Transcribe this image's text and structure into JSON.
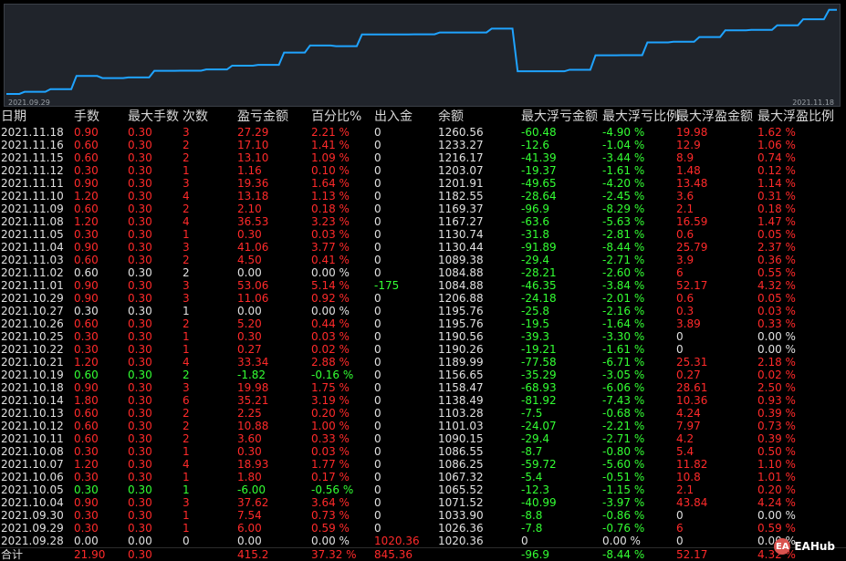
{
  "colors": {
    "white": "#e0e0e0",
    "red": "#ff2a2a",
    "green": "#33ff33",
    "line": "#1fa3ff"
  },
  "chart": {
    "x_start_label": "2021.09.29",
    "x_end_label": "2021.11.18"
  },
  "chart_data": {
    "type": "line",
    "x": [
      "2021.09.28",
      "2021.09.29",
      "2021.09.30",
      "2021.10.04",
      "2021.10.05",
      "2021.10.06",
      "2021.10.07",
      "2021.10.08",
      "2021.10.11",
      "2021.10.12",
      "2021.10.13",
      "2021.10.14",
      "2021.10.18",
      "2021.10.19",
      "2021.10.21",
      "2021.10.22",
      "2021.10.25",
      "2021.10.26",
      "2021.10.27",
      "2021.10.29",
      "2021.11.01",
      "2021.11.02",
      "2021.11.03",
      "2021.11.04",
      "2021.11.05",
      "2021.11.08",
      "2021.11.09",
      "2021.11.10",
      "2021.11.11",
      "2021.11.12",
      "2021.11.15",
      "2021.11.16",
      "2021.11.18"
    ],
    "values": [
      1020.36,
      1026.36,
      1033.9,
      1071.52,
      1065.52,
      1067.32,
      1086.25,
      1086.55,
      1090.15,
      1101.03,
      1103.28,
      1138.49,
      1158.47,
      1156.65,
      1189.99,
      1190.26,
      1190.56,
      1195.76,
      1195.76,
      1206.88,
      1084.88,
      1084.88,
      1089.38,
      1130.44,
      1130.74,
      1167.27,
      1169.37,
      1182.55,
      1201.91,
      1203.07,
      1216.17,
      1233.27,
      1260.56
    ],
    "ylim": [
      1015,
      1265
    ]
  },
  "table": {
    "headers": [
      "日期",
      "手数",
      "最大手数",
      "次数",
      "盈亏金额",
      "百分比%",
      "出入金",
      "余额",
      "最大浮亏金额",
      "最大浮亏比例",
      "最大浮盈金额",
      "最大浮盈比例"
    ],
    "rows": [
      {
        "date": "2021.11.18",
        "lots": "0.90",
        "maxlots": "0.30",
        "count": "3",
        "pnl": "27.29",
        "pct": "2.21 %",
        "flow": "0",
        "bal": "1260.56",
        "mdd": "-60.48",
        "mddp": "-4.90 %",
        "mfe": "19.98",
        "mfep": "1.62 %",
        "c": "red"
      },
      {
        "date": "2021.11.16",
        "lots": "0.60",
        "maxlots": "0.30",
        "count": "2",
        "pnl": "17.10",
        "pct": "1.41 %",
        "flow": "0",
        "bal": "1233.27",
        "mdd": "-12.6",
        "mddp": "-1.04 %",
        "mfe": "12.9",
        "mfep": "1.06 %",
        "c": "red"
      },
      {
        "date": "2021.11.15",
        "lots": "0.60",
        "maxlots": "0.30",
        "count": "2",
        "pnl": "13.10",
        "pct": "1.09 %",
        "flow": "0",
        "bal": "1216.17",
        "mdd": "-41.39",
        "mddp": "-3.44 %",
        "mfe": "8.9",
        "mfep": "0.74 %",
        "c": "red"
      },
      {
        "date": "2021.11.12",
        "lots": "0.30",
        "maxlots": "0.30",
        "count": "1",
        "pnl": "1.16",
        "pct": "0.10 %",
        "flow": "0",
        "bal": "1203.07",
        "mdd": "-19.37",
        "mddp": "-1.61 %",
        "mfe": "1.48",
        "mfep": "0.12 %",
        "c": "red"
      },
      {
        "date": "2021.11.11",
        "lots": "0.90",
        "maxlots": "0.30",
        "count": "3",
        "pnl": "19.36",
        "pct": "1.64 %",
        "flow": "0",
        "bal": "1201.91",
        "mdd": "-49.65",
        "mddp": "-4.20 %",
        "mfe": "13.48",
        "mfep": "1.14 %",
        "c": "red"
      },
      {
        "date": "2021.11.10",
        "lots": "1.20",
        "maxlots": "0.30",
        "count": "4",
        "pnl": "13.18",
        "pct": "1.13 %",
        "flow": "0",
        "bal": "1182.55",
        "mdd": "-28.64",
        "mddp": "-2.45 %",
        "mfe": "3.6",
        "mfep": "0.31 %",
        "c": "red"
      },
      {
        "date": "2021.11.09",
        "lots": "0.60",
        "maxlots": "0.30",
        "count": "2",
        "pnl": "2.10",
        "pct": "0.18 %",
        "flow": "0",
        "bal": "1169.37",
        "mdd": "-96.9",
        "mddp": "-8.29 %",
        "mfe": "2.1",
        "mfep": "0.18 %",
        "c": "red"
      },
      {
        "date": "2021.11.08",
        "lots": "1.20",
        "maxlots": "0.30",
        "count": "4",
        "pnl": "36.53",
        "pct": "3.23 %",
        "flow": "0",
        "bal": "1167.27",
        "mdd": "-63.6",
        "mddp": "-5.63 %",
        "mfe": "16.59",
        "mfep": "1.47 %",
        "c": "red"
      },
      {
        "date": "2021.11.05",
        "lots": "0.30",
        "maxlots": "0.30",
        "count": "1",
        "pnl": "0.30",
        "pct": "0.03 %",
        "flow": "0",
        "bal": "1130.74",
        "mdd": "-31.8",
        "mddp": "-2.81 %",
        "mfe": "0.6",
        "mfep": "0.05 %",
        "c": "red"
      },
      {
        "date": "2021.11.04",
        "lots": "0.90",
        "maxlots": "0.30",
        "count": "3",
        "pnl": "41.06",
        "pct": "3.77 %",
        "flow": "0",
        "bal": "1130.44",
        "mdd": "-91.89",
        "mddp": "-8.44 %",
        "mfe": "25.79",
        "mfep": "2.37 %",
        "c": "red"
      },
      {
        "date": "2021.11.03",
        "lots": "0.60",
        "maxlots": "0.30",
        "count": "2",
        "pnl": "4.50",
        "pct": "0.41 %",
        "flow": "0",
        "bal": "1089.38",
        "mdd": "-29.4",
        "mddp": "-2.71 %",
        "mfe": "3.9",
        "mfep": "0.36 %",
        "c": "red"
      },
      {
        "date": "2021.11.02",
        "lots": "0.60",
        "maxlots": "0.30",
        "count": "2",
        "pnl": "0.00",
        "pct": "0.00 %",
        "flow": "0",
        "bal": "1084.88",
        "mdd": "-28.21",
        "mddp": "-2.60 %",
        "mfe": "6",
        "mfep": "0.55 %",
        "c": "white"
      },
      {
        "date": "2021.11.01",
        "lots": "0.90",
        "maxlots": "0.30",
        "count": "3",
        "pnl": "53.06",
        "pct": "5.14 %",
        "flow": "-175",
        "bal": "1084.88",
        "mdd": "-46.35",
        "mddp": "-3.84 %",
        "mfe": "52.17",
        "mfep": "4.32 %",
        "c": "red"
      },
      {
        "date": "2021.10.29",
        "lots": "0.90",
        "maxlots": "0.30",
        "count": "3",
        "pnl": "11.06",
        "pct": "0.92 %",
        "flow": "0",
        "bal": "1206.88",
        "mdd": "-24.18",
        "mddp": "-2.01 %",
        "mfe": "0.6",
        "mfep": "0.05 %",
        "c": "red"
      },
      {
        "date": "2021.10.27",
        "lots": "0.30",
        "maxlots": "0.30",
        "count": "1",
        "pnl": "0.00",
        "pct": "0.00 %",
        "flow": "0",
        "bal": "1195.76",
        "mdd": "-25.8",
        "mddp": "-2.16 %",
        "mfe": "0.3",
        "mfep": "0.03 %",
        "c": "white"
      },
      {
        "date": "2021.10.26",
        "lots": "0.60",
        "maxlots": "0.30",
        "count": "2",
        "pnl": "5.20",
        "pct": "0.44 %",
        "flow": "0",
        "bal": "1195.76",
        "mdd": "-19.5",
        "mddp": "-1.64 %",
        "mfe": "3.89",
        "mfep": "0.33 %",
        "c": "red"
      },
      {
        "date": "2021.10.25",
        "lots": "0.30",
        "maxlots": "0.30",
        "count": "1",
        "pnl": "0.30",
        "pct": "0.03 %",
        "flow": "0",
        "bal": "1190.56",
        "mdd": "-39.3",
        "mddp": "-3.30 %",
        "mfe": "0",
        "mfep": "0.00 %",
        "c": "red"
      },
      {
        "date": "2021.10.22",
        "lots": "0.30",
        "maxlots": "0.30",
        "count": "1",
        "pnl": "0.27",
        "pct": "0.02 %",
        "flow": "0",
        "bal": "1190.26",
        "mdd": "-19.21",
        "mddp": "-1.61 %",
        "mfe": "0",
        "mfep": "0.00 %",
        "c": "red"
      },
      {
        "date": "2021.10.21",
        "lots": "1.20",
        "maxlots": "0.30",
        "count": "4",
        "pnl": "33.34",
        "pct": "2.88 %",
        "flow": "0",
        "bal": "1189.99",
        "mdd": "-77.58",
        "mddp": "-6.71 %",
        "mfe": "25.31",
        "mfep": "2.18 %",
        "c": "red"
      },
      {
        "date": "2021.10.19",
        "lots": "0.60",
        "maxlots": "0.30",
        "count": "2",
        "pnl": "-1.82",
        "pct": "-0.16 %",
        "flow": "0",
        "bal": "1156.65",
        "mdd": "-35.29",
        "mddp": "-3.05 %",
        "mfe": "0.27",
        "mfep": "0.02 %",
        "c": "green"
      },
      {
        "date": "2021.10.18",
        "lots": "0.90",
        "maxlots": "0.30",
        "count": "3",
        "pnl": "19.98",
        "pct": "1.75 %",
        "flow": "0",
        "bal": "1158.47",
        "mdd": "-68.93",
        "mddp": "-6.06 %",
        "mfe": "28.61",
        "mfep": "2.50 %",
        "c": "red"
      },
      {
        "date": "2021.10.14",
        "lots": "1.80",
        "maxlots": "0.30",
        "count": "6",
        "pnl": "35.21",
        "pct": "3.19 %",
        "flow": "0",
        "bal": "1138.49",
        "mdd": "-81.92",
        "mddp": "-7.43 %",
        "mfe": "10.36",
        "mfep": "0.93 %",
        "c": "red"
      },
      {
        "date": "2021.10.13",
        "lots": "0.60",
        "maxlots": "0.30",
        "count": "2",
        "pnl": "2.25",
        "pct": "0.20 %",
        "flow": "0",
        "bal": "1103.28",
        "mdd": "-7.5",
        "mddp": "-0.68 %",
        "mfe": "4.24",
        "mfep": "0.39 %",
        "c": "red"
      },
      {
        "date": "2021.10.12",
        "lots": "0.60",
        "maxlots": "0.30",
        "count": "2",
        "pnl": "10.88",
        "pct": "1.00 %",
        "flow": "0",
        "bal": "1101.03",
        "mdd": "-24.07",
        "mddp": "-2.21 %",
        "mfe": "7.97",
        "mfep": "0.73 %",
        "c": "red"
      },
      {
        "date": "2021.10.11",
        "lots": "0.60",
        "maxlots": "0.30",
        "count": "2",
        "pnl": "3.60",
        "pct": "0.33 %",
        "flow": "0",
        "bal": "1090.15",
        "mdd": "-29.4",
        "mddp": "-2.71 %",
        "mfe": "4.2",
        "mfep": "0.39 %",
        "c": "red"
      },
      {
        "date": "2021.10.08",
        "lots": "0.30",
        "maxlots": "0.30",
        "count": "1",
        "pnl": "0.30",
        "pct": "0.03 %",
        "flow": "0",
        "bal": "1086.55",
        "mdd": "-8.7",
        "mddp": "-0.80 %",
        "mfe": "5.4",
        "mfep": "0.50 %",
        "c": "red"
      },
      {
        "date": "2021.10.07",
        "lots": "1.20",
        "maxlots": "0.30",
        "count": "4",
        "pnl": "18.93",
        "pct": "1.77 %",
        "flow": "0",
        "bal": "1086.25",
        "mdd": "-59.72",
        "mddp": "-5.60 %",
        "mfe": "11.82",
        "mfep": "1.10 %",
        "c": "red"
      },
      {
        "date": "2021.10.06",
        "lots": "0.30",
        "maxlots": "0.30",
        "count": "1",
        "pnl": "1.80",
        "pct": "0.17 %",
        "flow": "0",
        "bal": "1067.32",
        "mdd": "-5.4",
        "mddp": "-0.51 %",
        "mfe": "10.8",
        "mfep": "1.01 %",
        "c": "red"
      },
      {
        "date": "2021.10.05",
        "lots": "0.30",
        "maxlots": "0.30",
        "count": "1",
        "pnl": "-6.00",
        "pct": "-0.56 %",
        "flow": "0",
        "bal": "1065.52",
        "mdd": "-12.3",
        "mddp": "-1.15 %",
        "mfe": "2.1",
        "mfep": "0.20 %",
        "c": "green"
      },
      {
        "date": "2021.10.04",
        "lots": "0.90",
        "maxlots": "0.30",
        "count": "3",
        "pnl": "37.62",
        "pct": "3.64 %",
        "flow": "0",
        "bal": "1071.52",
        "mdd": "-40.99",
        "mddp": "-3.97 %",
        "mfe": "43.84",
        "mfep": "4.24 %",
        "c": "red"
      },
      {
        "date": "2021.09.30",
        "lots": "0.30",
        "maxlots": "0.30",
        "count": "1",
        "pnl": "7.54",
        "pct": "0.73 %",
        "flow": "0",
        "bal": "1033.90",
        "mdd": "-8.8",
        "mddp": "-0.86 %",
        "mfe": "0",
        "mfep": "0.00 %",
        "c": "red"
      },
      {
        "date": "2021.09.29",
        "lots": "0.30",
        "maxlots": "0.30",
        "count": "1",
        "pnl": "6.00",
        "pct": "0.59 %",
        "flow": "0",
        "bal": "1026.36",
        "mdd": "-7.8",
        "mddp": "-0.76 %",
        "mfe": "6",
        "mfep": "0.59 %",
        "c": "red"
      },
      {
        "date": "2021.09.28",
        "lots": "0.00",
        "maxlots": "0.00",
        "count": "0",
        "pnl": "0.00",
        "pct": "0.00 %",
        "flow": "1020.36",
        "bal": "1020.36",
        "mdd": "0",
        "mddp": "0.00 %",
        "mfe": "0",
        "mfep": "0.00 %",
        "c": "white"
      }
    ],
    "total": {
      "label": "合计",
      "lots": "21.90",
      "maxlots": "0.30",
      "count": "",
      "pnl": "415.2",
      "pct": "37.32 %",
      "flow": "845.36",
      "bal": "",
      "mdd": "-96.9",
      "mddp": "-8.44 %",
      "mfe": "52.17",
      "mfep": "4.32 %"
    }
  },
  "logo": {
    "mark": "EA",
    "text": "EAHub"
  }
}
